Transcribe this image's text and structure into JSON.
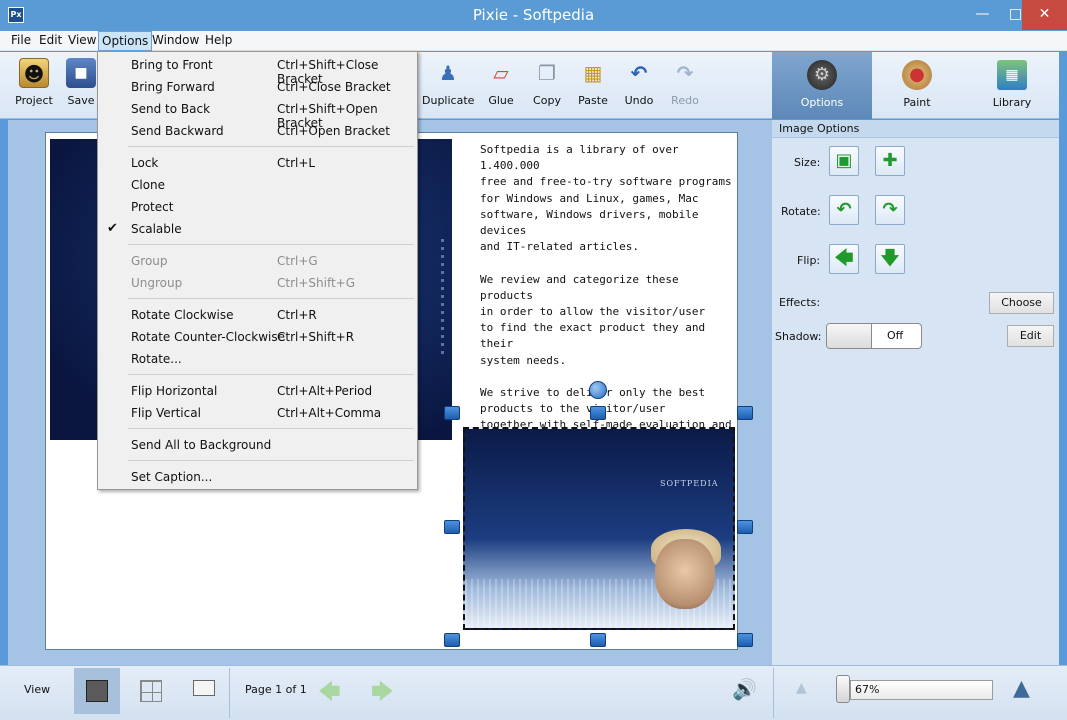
{
  "window": {
    "title": "Pixie - Softpedia",
    "icon_text": "Px"
  },
  "menubar": {
    "items": [
      "File",
      "Edit",
      "View",
      "Options",
      "Window",
      "Help"
    ],
    "active": "Options"
  },
  "toolbar": {
    "project": "Project",
    "save": "Save",
    "duplicate": "Duplicate",
    "glue": "Glue",
    "copy": "Copy",
    "paste": "Paste",
    "undo": "Undo",
    "redo": "Redo"
  },
  "right_tabs": {
    "options": "Options",
    "paint": "Paint",
    "library": "Library"
  },
  "dropdown": {
    "bring_to_front": {
      "label": "Bring to Front",
      "shortcut": "Ctrl+Shift+Close Bracket"
    },
    "bring_forward": {
      "label": "Bring Forward",
      "shortcut": "Ctrl+Close Bracket"
    },
    "send_to_back": {
      "label": "Send to Back",
      "shortcut": "Ctrl+Shift+Open Bracket"
    },
    "send_backward": {
      "label": "Send Backward",
      "shortcut": "Ctrl+Open Bracket"
    },
    "lock": {
      "label": "Lock",
      "shortcut": "Ctrl+L"
    },
    "clone": {
      "label": "Clone",
      "shortcut": ""
    },
    "protect": {
      "label": "Protect",
      "shortcut": ""
    },
    "scalable": {
      "label": "Scalable",
      "shortcut": "",
      "checked": true
    },
    "group": {
      "label": "Group",
      "shortcut": "Ctrl+G",
      "enabled": false
    },
    "ungroup": {
      "label": "Ungroup",
      "shortcut": "Ctrl+Shift+G",
      "enabled": false
    },
    "rotate_cw": {
      "label": "Rotate Clockwise",
      "shortcut": "Ctrl+R"
    },
    "rotate_ccw": {
      "label": "Rotate Counter-Clockwise",
      "shortcut": "Ctrl+Shift+R"
    },
    "rotate": {
      "label": "Rotate...",
      "shortcut": ""
    },
    "flip_h": {
      "label": "Flip Horizontal",
      "shortcut": "Ctrl+Alt+Period"
    },
    "flip_v": {
      "label": "Flip Vertical",
      "shortcut": "Ctrl+Alt+Comma"
    },
    "send_all_bg": {
      "label": "Send All to Background",
      "shortcut": ""
    },
    "set_caption": {
      "label": "Set Caption...",
      "shortcut": ""
    }
  },
  "canvas": {
    "text": "Softpedia is a library of over 1.400.000\nfree and free-to-try software programs\nfor Windows and Linux, games, Mac\nsoftware, Windows drivers, mobile\ndevices\nand IT-related articles.\n\nWe review and categorize these products\nin order to allow the visitor/user\nto find the exact product they and their\nsystem needs.\n\nWe strive to deliver only the best\nproducts to the visitor/user\ntogether with self-made evaluation and\nreview notes.",
    "photo_logo": "SOFTPEDIA"
  },
  "image_options": {
    "header": "Image Options",
    "size_label": "Size:",
    "rotate_label": "Rotate:",
    "flip_label": "Flip:",
    "effects_label": "Effects:",
    "choose_button": "Choose",
    "shadow_label": "Shadow:",
    "shadow_state": "Off",
    "edit_button": "Edit"
  },
  "statusbar": {
    "view_label": "View",
    "page_label": "Page 1 of 1",
    "zoom": "67%"
  },
  "colors": {
    "titlebar": "#5b9bd5",
    "close": "#c74a41",
    "menu_highlight": "#cce4f7",
    "panel": "#d6e4f3"
  }
}
